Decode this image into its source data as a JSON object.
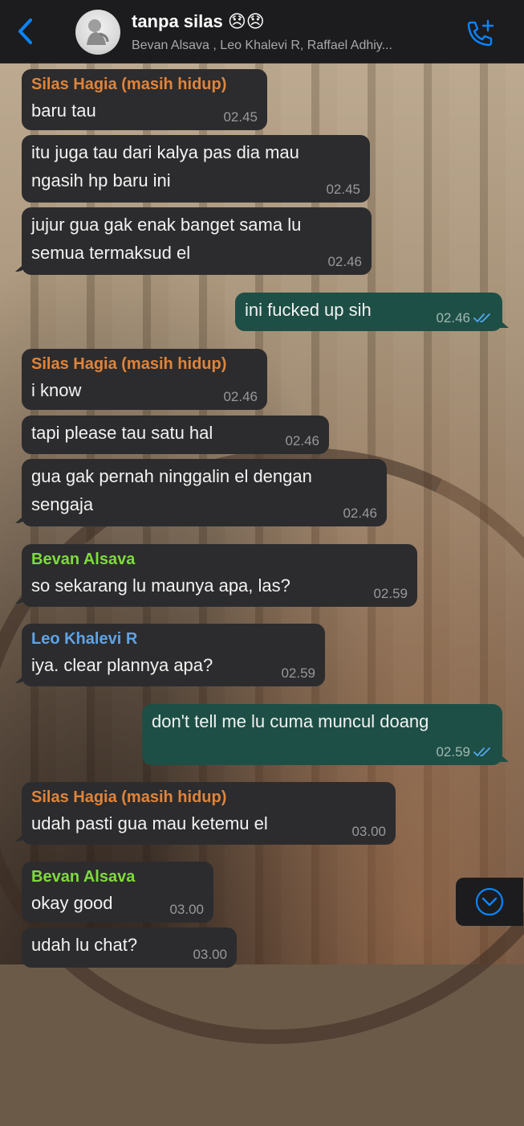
{
  "header": {
    "back_icon": "chevron-left-icon",
    "title": "tanpa silas 😞😞",
    "subtitle": "Bevan Alsava , Leo Khalevi R, Raffael Adhiy...",
    "call_icon": "add-call-icon"
  },
  "colors": {
    "silas": "#e0843a",
    "bevan": "#7ddc3a",
    "leo": "#5ea4e8",
    "incoming_bubble": "#2c2c2e",
    "outgoing_bubble": "#1e4f46",
    "read_ticks": "#54a8f0"
  },
  "messages": [
    {
      "sender": "Silas Hagia (masih hidup)",
      "lines": [
        "baru tau"
      ],
      "time": "02.45"
    },
    {
      "lines": [
        "itu juga tau dari kalya pas dia mau",
        "ngasih hp baru ini"
      ],
      "time": "02.45"
    },
    {
      "lines": [
        "jujur gua gak enak banget sama lu",
        "semua termaksud el"
      ],
      "time": "02.46"
    },
    {
      "lines": [
        "ini fucked up sih"
      ],
      "time": "02.46"
    },
    {
      "sender": "Silas Hagia (masih hidup)",
      "lines": [
        "i know"
      ],
      "time": "02.46"
    },
    {
      "lines": [
        "tapi please tau satu hal"
      ],
      "time": "02.46"
    },
    {
      "lines": [
        "gua gak pernah ninggalin el dengan",
        "sengaja"
      ],
      "time": "02.46"
    },
    {
      "sender": "Bevan Alsava",
      "lines": [
        "so sekarang lu maunya apa, las?"
      ],
      "time": "02.59"
    },
    {
      "sender": "Leo Khalevi R",
      "lines": [
        "iya. clear plannya apa?"
      ],
      "time": "02.59"
    },
    {
      "lines": [
        "don't tell me lu cuma muncul doang"
      ],
      "time": "02.59"
    },
    {
      "sender": "Silas Hagia (masih hidup)",
      "lines": [
        "udah pasti gua mau ketemu el"
      ],
      "time": "03.00"
    },
    {
      "sender": "Bevan Alsava",
      "lines": [
        "okay good"
      ],
      "time": "03.00"
    },
    {
      "lines": [
        "udah lu chat?"
      ],
      "time": "03.00"
    }
  ],
  "scroll_icon": "chevron-down-circle-icon"
}
